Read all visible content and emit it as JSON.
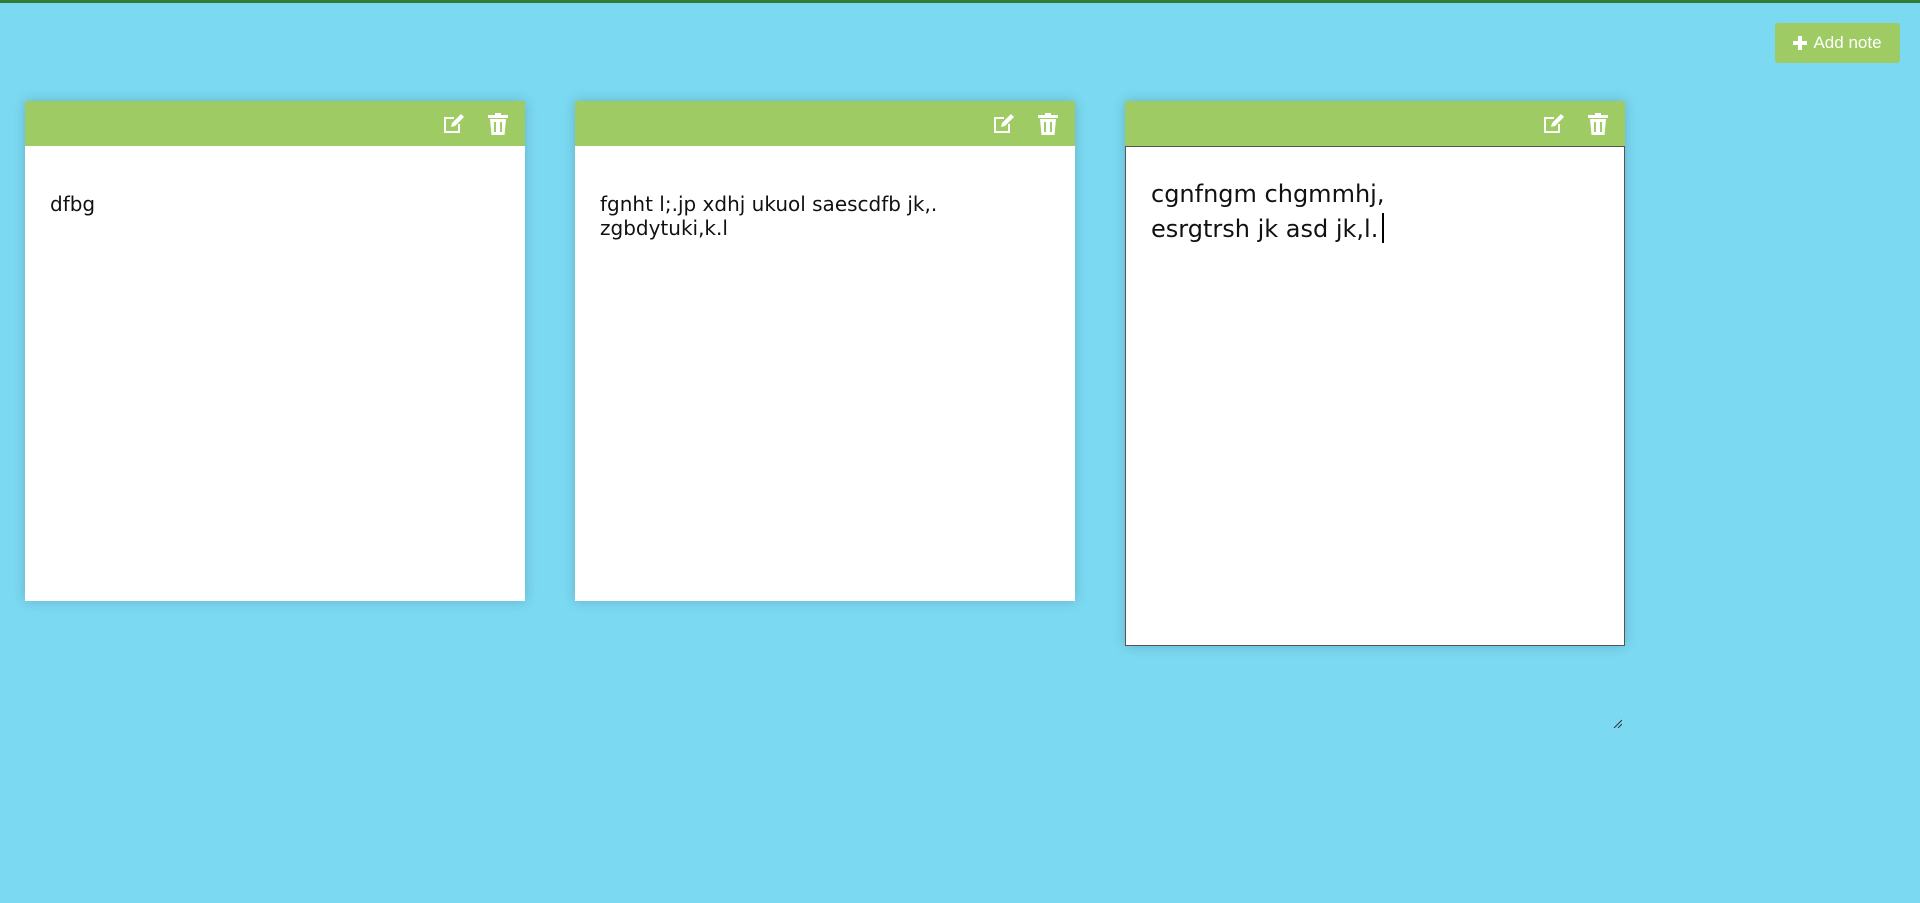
{
  "toolbar": {
    "add_label": "Add note"
  },
  "notes": [
    {
      "text": "dfbg"
    },
    {
      "text": "fgnht l;.jp xdhj ukuol saescdfb jk,. zgbdytuki,k.l"
    },
    {
      "text": "cgnfngm chgmmhj,\nesrgtrsh jk asd jk,l."
    }
  ],
  "colors": {
    "background": "#7bd9f2",
    "header": "#9ecb63",
    "top_border": "#2e7d32"
  },
  "icons": [
    "plus-icon",
    "edit-icon",
    "trash-icon"
  ]
}
